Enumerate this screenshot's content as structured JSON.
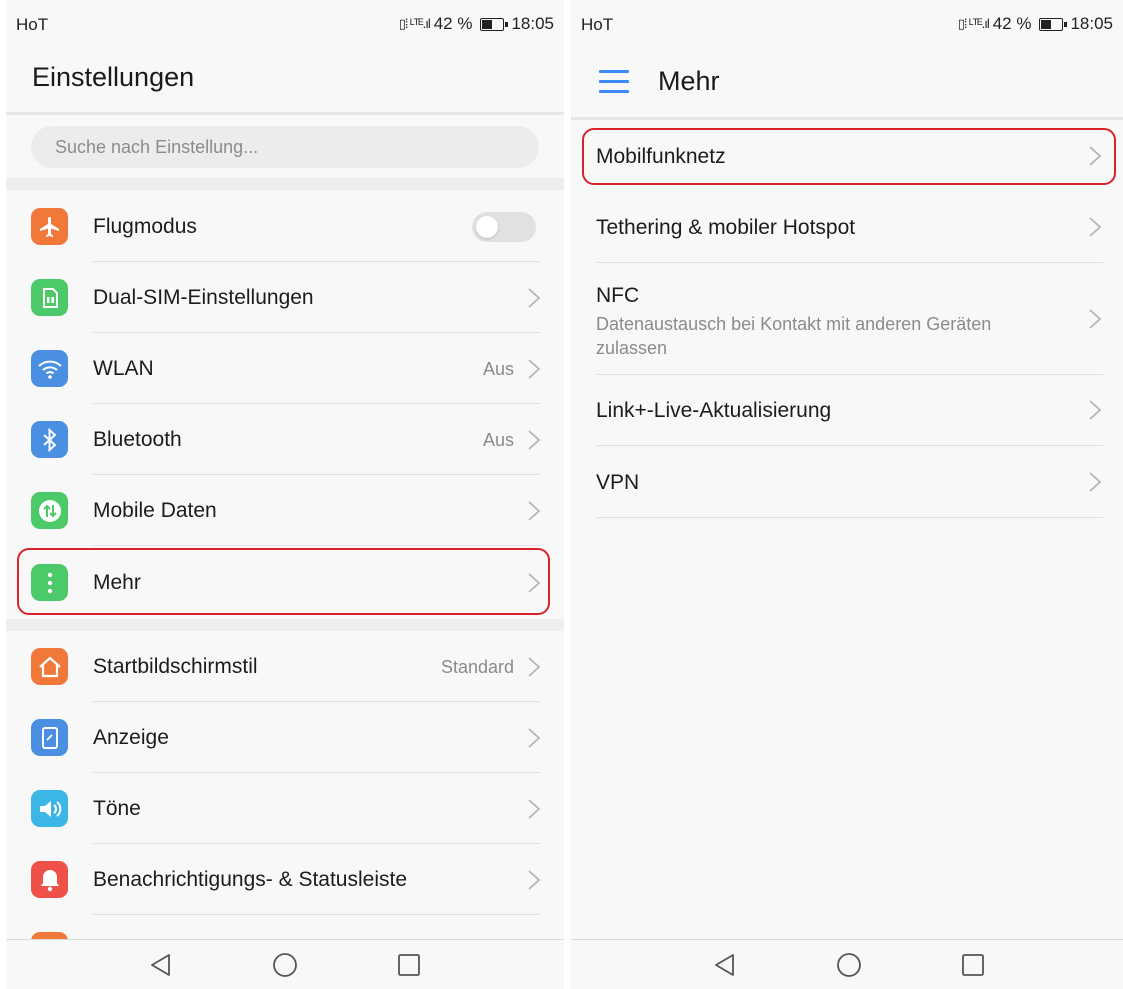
{
  "status_bar": {
    "carrier": "HoT",
    "signal_glyph": "▯⁞ ᴸᵀᴱ.ıl",
    "battery": "42 %",
    "time": "18:05"
  },
  "settings": {
    "title": "Einstellungen",
    "search_placeholder": "Suche nach Einstellung...",
    "items": [
      {
        "label": "Flugmodus",
        "icon": "airplane-icon",
        "color": "#f0793a",
        "control": "toggle",
        "toggle_on": false
      },
      {
        "label": "Dual-SIM-Einstellungen",
        "icon": "sim-card-icon",
        "color": "#4cca6a"
      },
      {
        "label": "WLAN",
        "icon": "wifi-icon",
        "color": "#4a8fe2",
        "value": "Aus"
      },
      {
        "label": "Bluetooth",
        "icon": "bluetooth-icon",
        "color": "#4a8fe2",
        "value": "Aus"
      },
      {
        "label": "Mobile Daten",
        "icon": "mobile-data-icon",
        "color": "#4cca6a"
      },
      {
        "label": "Mehr",
        "icon": "more-icon",
        "color": "#4cca6a"
      },
      {
        "label": "Startbildschirmstil",
        "icon": "home-icon",
        "color": "#f0793a",
        "value": "Standard"
      },
      {
        "label": "Anzeige",
        "icon": "display-icon",
        "color": "#4a8fe2"
      },
      {
        "label": "Töne",
        "icon": "sound-icon",
        "color": "#3cb6e4"
      },
      {
        "label": "Benachrichtigungs- & Statusleiste",
        "icon": "notification-icon",
        "color": "#ef5148"
      }
    ]
  },
  "mehr": {
    "title": "Mehr",
    "items": [
      {
        "label": "Mobilfunknetz"
      },
      {
        "label": "Tethering & mobiler Hotspot"
      },
      {
        "label": "NFC",
        "subtitle": "Datenaustausch bei Kontakt mit anderen Geräten zulassen"
      },
      {
        "label": "Link+-Live-Aktualisierung"
      },
      {
        "label": "VPN"
      }
    ]
  },
  "colors": {
    "highlight": "#d8232a",
    "accent": "#3d8af7",
    "secondary_text": "#8b8b8b"
  }
}
